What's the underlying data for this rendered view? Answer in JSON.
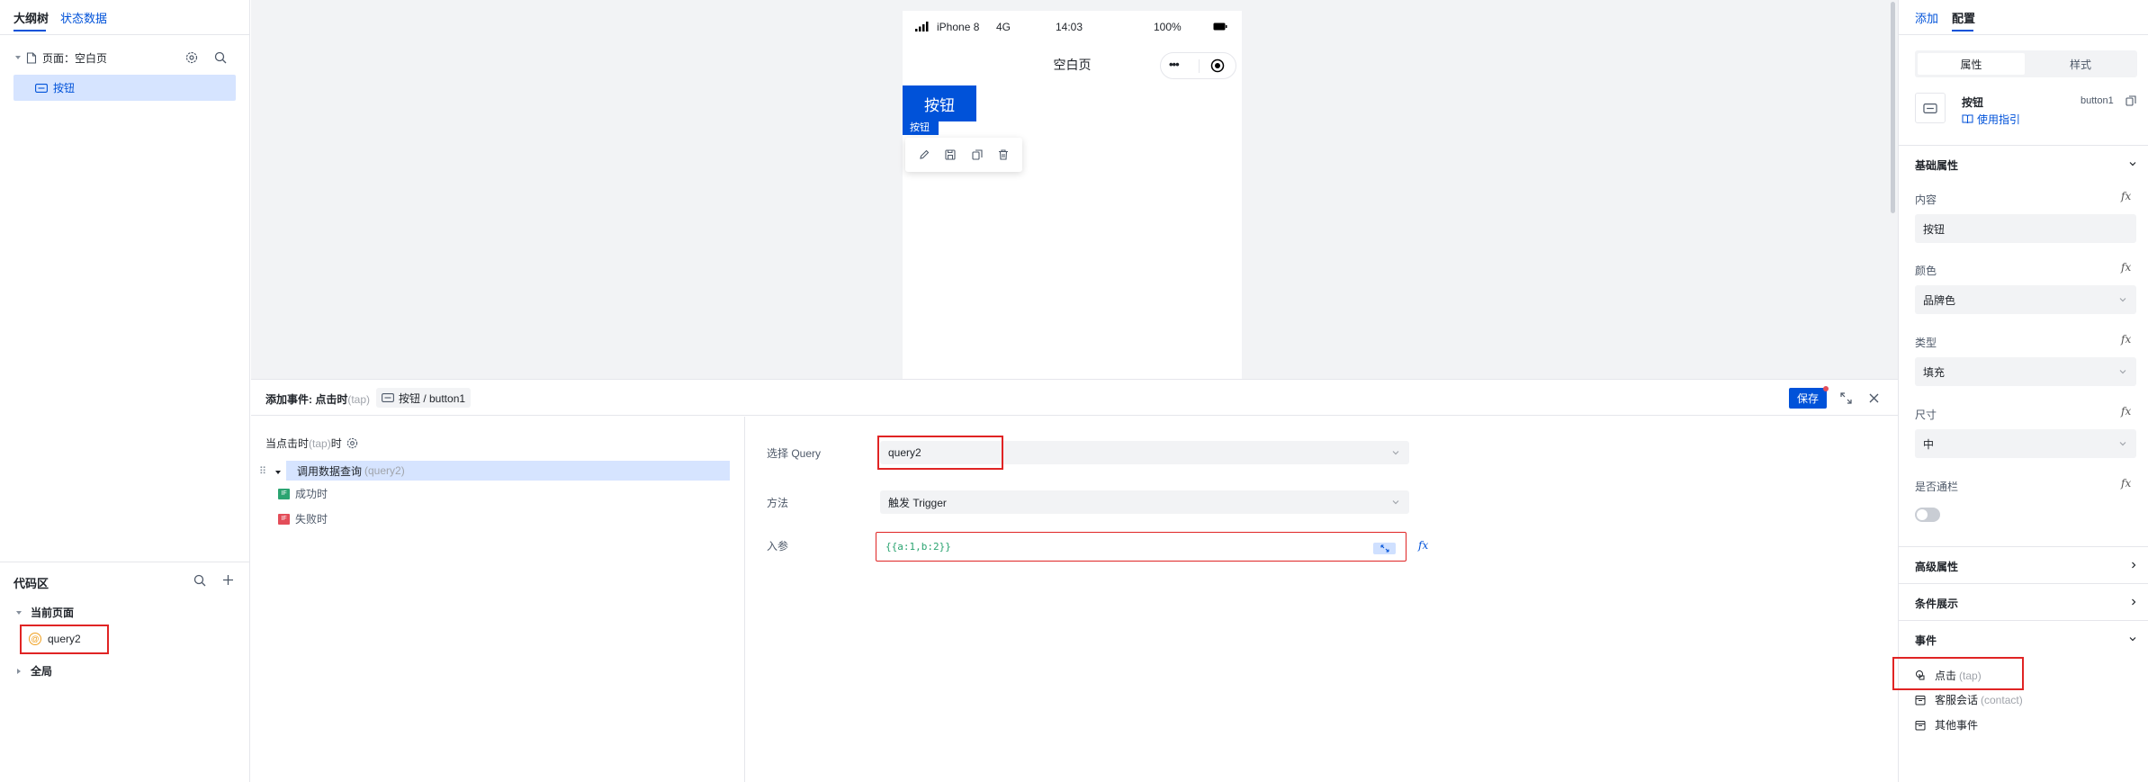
{
  "left_panel": {
    "tabs": [
      "大纲树",
      "状态数据"
    ],
    "active_tab": 0,
    "page_node_label": "页面：空白页",
    "button_node_label": "按钮"
  },
  "code_area": {
    "title": "代码区",
    "current_page_label": "当前页面",
    "query_item": "query2",
    "global_label": "全局"
  },
  "phone": {
    "carrier": "iPhone 8",
    "network": "4G",
    "time": "14:03",
    "battery": "100%",
    "page_title": "空白页",
    "more_icon": "•••",
    "button_text": "按钮",
    "selected_tag": "按钮"
  },
  "event_panel": {
    "title_prefix": "添加事件: 点击时",
    "title_suffix": "(tap)",
    "component_path": "按钮 / button1",
    "save_label": "保存",
    "trigger_label": "当点击时",
    "trigger_sub": "(tap)",
    "trigger_end": "时",
    "action_label": "调用数据查询",
    "action_sub": "(query2)",
    "success_label": "成功时",
    "fail_label": "失败时",
    "if_badge": "IF",
    "select_query_label": "选择 Query",
    "select_query_value": "query2",
    "method_label": "方法",
    "method_value": "触发 Trigger",
    "params_label": "入参",
    "params_value": "{{a:1,b:2}}"
  },
  "right_panel": {
    "tabs": [
      "添加",
      "配置"
    ],
    "active_tab": 1,
    "seg_tabs": [
      "属性",
      "样式"
    ],
    "active_seg": 0,
    "component_name": "按钮",
    "component_id": "button1",
    "usage_guide": "使用指引",
    "basic_props": "基础属性",
    "content_label": "内容",
    "content_value": "按钮",
    "color_label": "颜色",
    "color_value": "品牌色",
    "type_label": "类型",
    "type_value": "填充",
    "size_label": "尺寸",
    "size_value": "中",
    "block_label": "是否通栏",
    "fx": "fx",
    "advanced_props": "高级属性",
    "conditional_display": "条件展示",
    "events_label": "事件",
    "events": [
      {
        "label": "点击",
        "sub": "(tap)"
      },
      {
        "label": "客服会话",
        "sub": "(contact)"
      },
      {
        "label": "其他事件",
        "sub": ""
      }
    ]
  },
  "colors": {
    "brand": "#0052d9",
    "highlight_red": "#e02424",
    "selection_bg": "#d6e4ff",
    "success_green": "#2ba471",
    "fail_red": "#e34d59"
  }
}
